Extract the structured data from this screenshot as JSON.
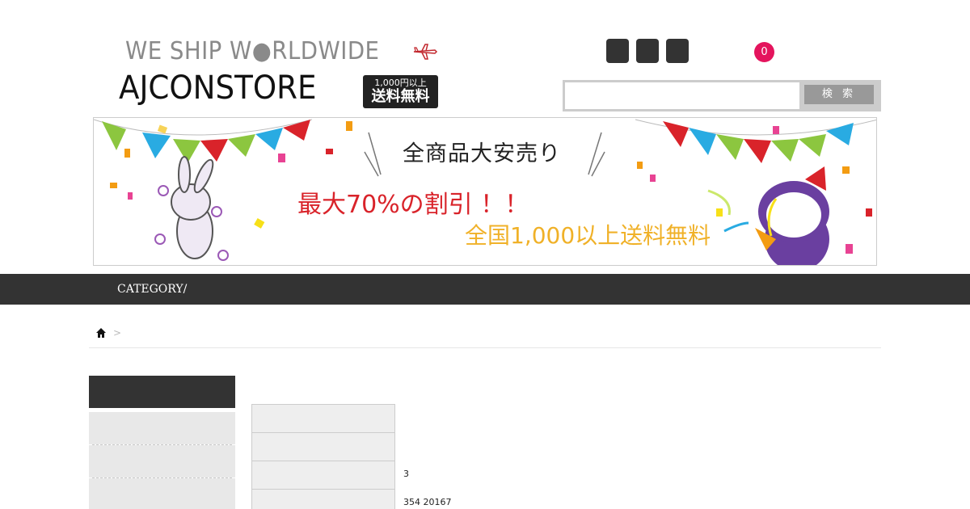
{
  "header": {
    "tagline": "WE SHIP W●RLDWIDE",
    "brand": "AJCONSTORE",
    "ship_badge_line1": "1,000円以上",
    "ship_badge_line2": "送料無料",
    "cart_count": "0"
  },
  "search": {
    "placeholder": "",
    "button_label": "検 索"
  },
  "banner": {
    "title": "全商品大安売り",
    "sale_text": "最大70%の割引 ！！",
    "shipping_text": "全国1,000以上送料無料"
  },
  "nav": {
    "category_label": "CATEGORY/"
  },
  "breadcrumb": {
    "separator": ">"
  },
  "details": {
    "values": [
      "",
      "",
      "3",
      "354 20167"
    ]
  },
  "colors": {
    "accent": "#e4145d",
    "nav_bg": "#333333",
    "sale_red": "#d9232a",
    "ship_yellow": "#f0b128"
  }
}
